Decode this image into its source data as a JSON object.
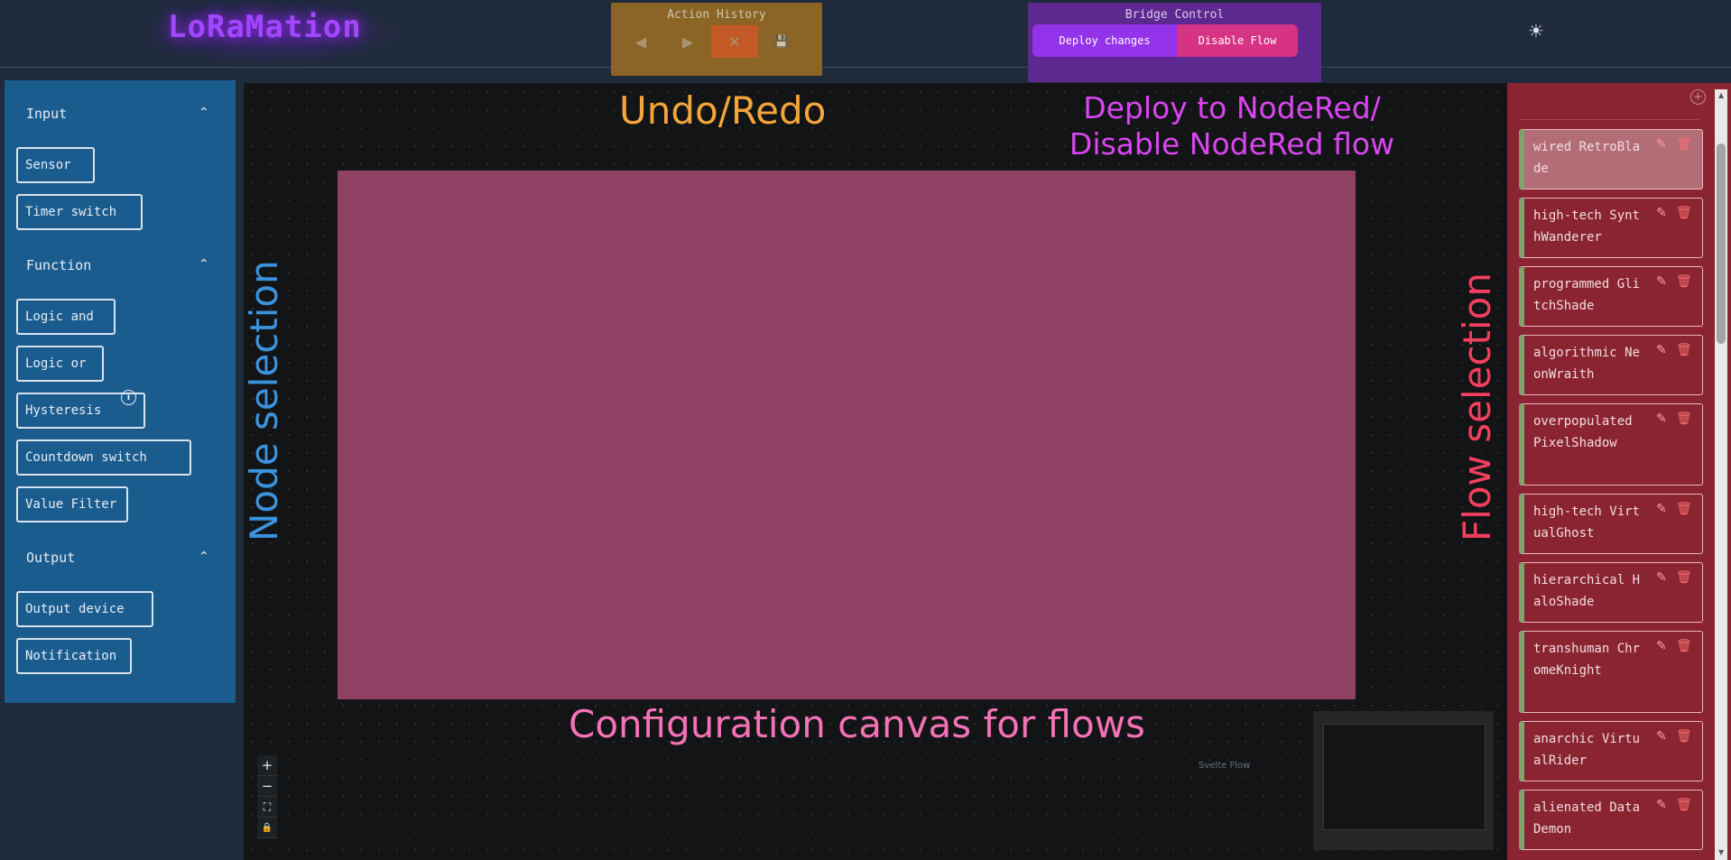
{
  "header": {
    "logo": "LoRaMation",
    "action_history": {
      "title": "Action History",
      "buttons": [
        {
          "name": "undo",
          "icon": "caret-left-icon",
          "glyph": "◀",
          "bg": "#93703a"
        },
        {
          "name": "redo",
          "icon": "caret-right-icon",
          "glyph": "▶",
          "bg": "#93703a"
        },
        {
          "name": "discard",
          "icon": "x-icon",
          "glyph": "✕",
          "bg": "#c35a25"
        },
        {
          "name": "save",
          "icon": "save-icon",
          "glyph": "💾",
          "bg": "#957a3e"
        }
      ]
    },
    "bridge_control": {
      "title": "Bridge Control",
      "deploy_label": "Deploy changes",
      "disable_label": "Disable Flow"
    },
    "theme_icon": "sun-icon"
  },
  "node_panel": {
    "sections": [
      {
        "title": "Input",
        "items": [
          "Sensor",
          "Timer switch"
        ]
      },
      {
        "title": "Function",
        "items": [
          "Logic and",
          "Logic or",
          "Hysteresis",
          "Countdown switch",
          "Value Filter"
        ]
      },
      {
        "title": "Output",
        "items": [
          "Output device",
          "Notification"
        ]
      }
    ]
  },
  "annotations": {
    "undo_redo": "Undo/Redo",
    "deploy_line1": "Deploy to NodeRed/",
    "deploy_line2": "Disable NodeRed flow",
    "node_selection": "Node selection",
    "flow_selection": "Flow selection",
    "canvas": "Configuration canvas for flows"
  },
  "canvas": {
    "zoom_controls": [
      "+",
      "−",
      "⛶",
      "🔒"
    ],
    "minimap_label": "Svelte Flow"
  },
  "flows": [
    {
      "name": "wired RetroBlade",
      "active": true
    },
    {
      "name": "high-tech SynthWanderer",
      "active": false
    },
    {
      "name": "programmed GlitchShade",
      "active": false
    },
    {
      "name": "algorithmic NeonWraith",
      "active": false
    },
    {
      "name": "overpopulated PixelShadow",
      "active": false
    },
    {
      "name": "high-tech VirtualGhost",
      "active": false
    },
    {
      "name": "hierarchical HaloShade",
      "active": false
    },
    {
      "name": "transhuman ChromeKnight",
      "active": false
    },
    {
      "name": "anarchic VirtualRider",
      "active": false
    },
    {
      "name": "alienated DataDemon",
      "active": false
    }
  ],
  "colors": {
    "accent_purple": "#9333ea",
    "accent_pink": "#d63384",
    "node_panel": "#1b5c8e",
    "flow_panel": "#8a2431",
    "flow_card_accent": "#7fa36b"
  }
}
